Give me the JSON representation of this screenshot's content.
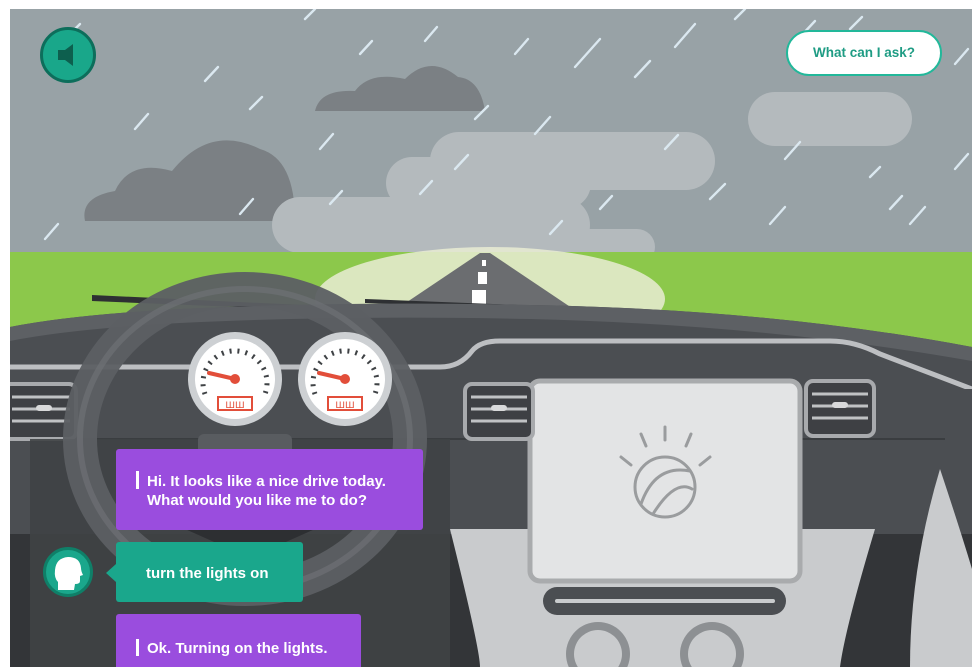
{
  "controls": {
    "audio_icon": "speaker-icon",
    "ask_button_label": "What can I ask?"
  },
  "dashboard": {
    "gauge_readouts": [
      "ШШ",
      "ШШ"
    ],
    "center_screen_logo": "globe-logo"
  },
  "chat": {
    "messages": [
      {
        "sender": "watson",
        "lines": [
          "Hi. It looks like a nice drive today.",
          "What would you like me to do?"
        ]
      },
      {
        "sender": "user",
        "text": "turn the lights on"
      },
      {
        "sender": "watson",
        "text": "Ok. Turning on the lights."
      }
    ],
    "user_avatar_icon": "user-head-icon"
  },
  "colors": {
    "sky": "#98a2a6",
    "grass": "#8cc84b",
    "road": "#6b6d70",
    "dashboard": "#4b4e52",
    "watson_bubble": "#9a4dde",
    "user_bubble": "#1aa78c",
    "accent": "#22b89a"
  }
}
